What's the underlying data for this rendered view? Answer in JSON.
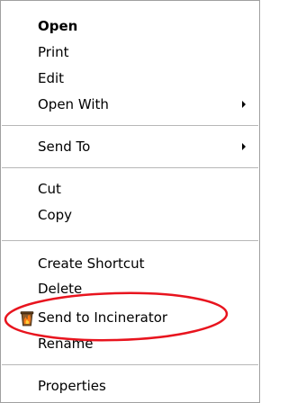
{
  "context_menu": {
    "items": [
      {
        "label": "Open"
      },
      {
        "label": "Print"
      },
      {
        "label": "Edit"
      },
      {
        "label": "Open With"
      },
      {
        "label": "Send To"
      },
      {
        "label": "Cut"
      },
      {
        "label": "Copy"
      },
      {
        "label": "Create Shortcut"
      },
      {
        "label": "Delete"
      },
      {
        "label": "Send to Incinerator",
        "icon": "incinerator-trash-icon"
      },
      {
        "label": "Rename"
      },
      {
        "label": "Properties"
      }
    ],
    "highlight_color": "#e8141e"
  }
}
